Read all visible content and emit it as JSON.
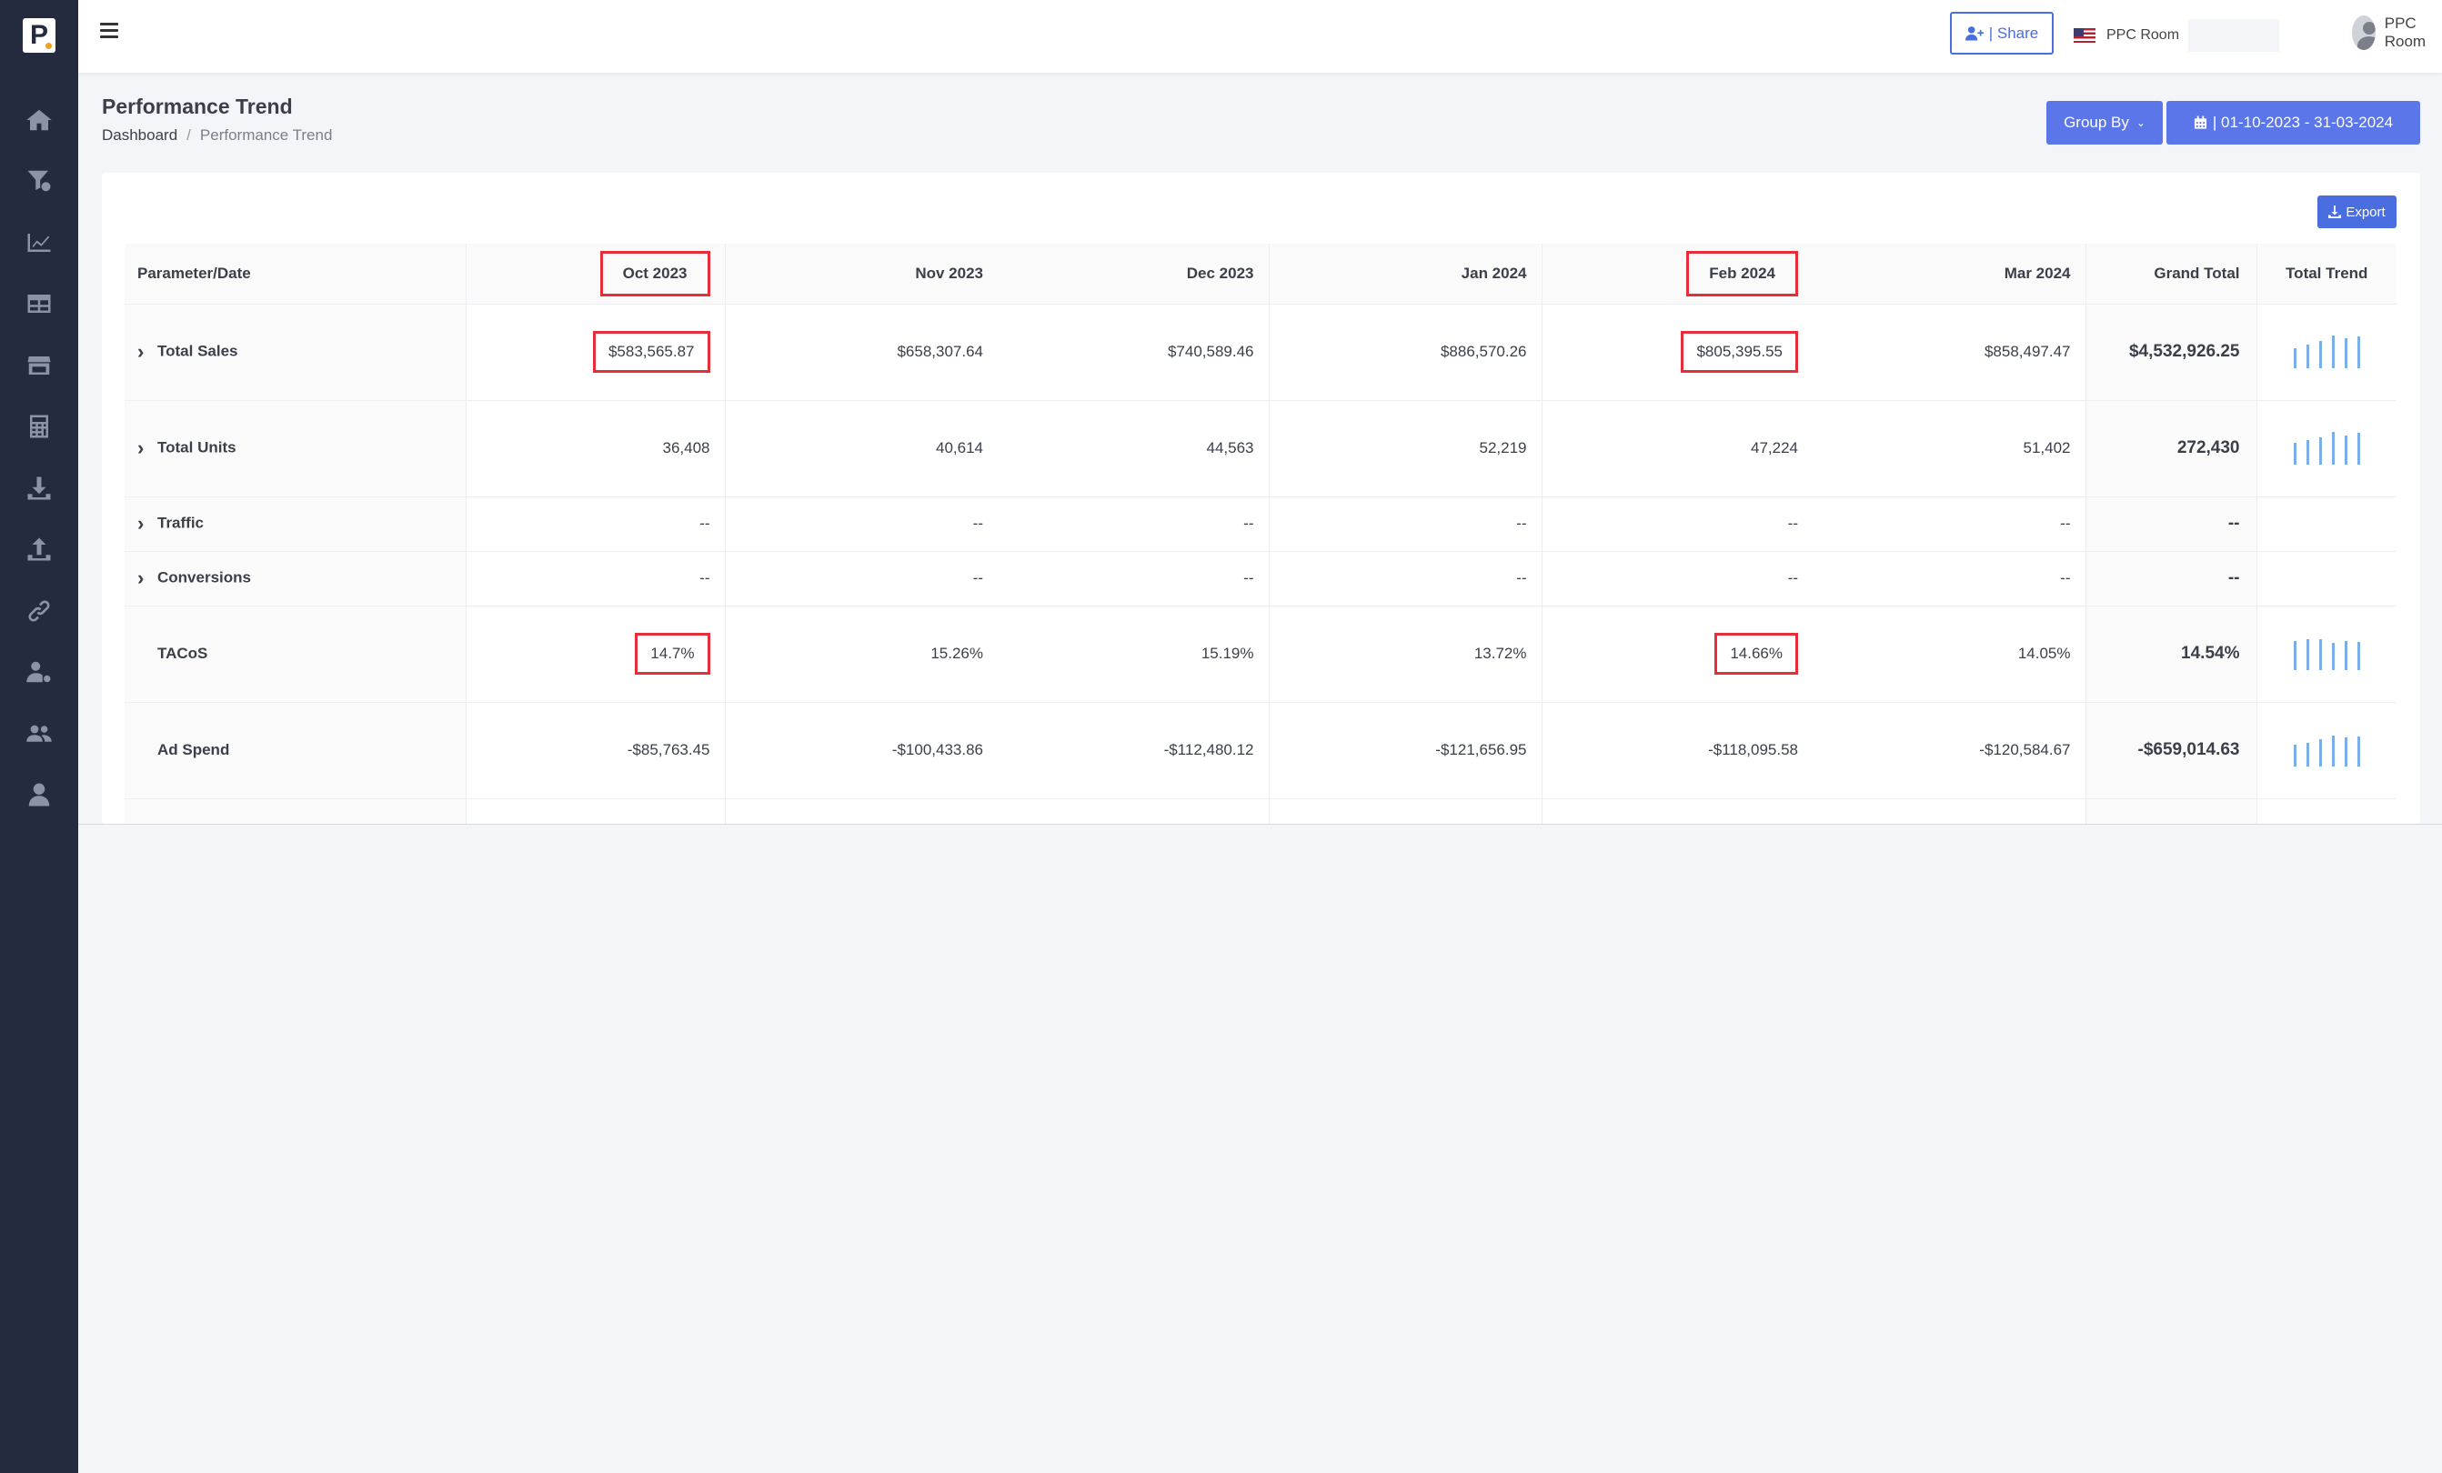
{
  "app": {
    "brand_letter": "P"
  },
  "sidebar": {
    "items": [
      {
        "name": "home-icon"
      },
      {
        "name": "filter-icon"
      },
      {
        "name": "chart-line-icon"
      },
      {
        "name": "table-icon"
      },
      {
        "name": "store-icon"
      },
      {
        "name": "calculator-icon"
      },
      {
        "name": "download-icon"
      },
      {
        "name": "upload-icon"
      },
      {
        "name": "link-icon"
      },
      {
        "name": "user-settings-icon"
      },
      {
        "name": "users-icon"
      },
      {
        "name": "user-icon"
      }
    ]
  },
  "topbar": {
    "share_label": "| Share",
    "account_name": "PPC Room",
    "user_name": "PPC Room"
  },
  "page": {
    "title": "Performance Trend",
    "breadcrumb": {
      "home": "Dashboard",
      "separator": "/",
      "current": "Performance Trend"
    },
    "group_by_label": "Group By",
    "date_range_label": "| 01-10-2023 - 31-03-2024",
    "export_label": "Export"
  },
  "table": {
    "headers": {
      "param": "Parameter/Date",
      "months": [
        "Oct 2023",
        "Nov 2023",
        "Dec 2023",
        "Jan 2024",
        "Feb 2024",
        "Mar 2024"
      ],
      "grand_total": "Grand Total",
      "trend": "Total Trend"
    },
    "rows": [
      {
        "label": "Total Sales",
        "values": [
          "$583,565.87",
          "$658,307.64",
          "$740,589.46",
          "$886,570.26",
          "$805,395.55",
          "$858,497.47"
        ],
        "total": "$4,532,926.25"
      },
      {
        "label": "Total Units",
        "values": [
          "36,408",
          "40,614",
          "44,563",
          "52,219",
          "47,224",
          "51,402"
        ],
        "total": "272,430"
      },
      {
        "label": "Traffic",
        "values": [
          "--",
          "--",
          "--",
          "--",
          "--",
          "--"
        ],
        "total": "--"
      },
      {
        "label": "Conversions",
        "values": [
          "--",
          "--",
          "--",
          "--",
          "--",
          "--"
        ],
        "total": "--"
      },
      {
        "label": "TACoS",
        "values": [
          "14.7%",
          "15.26%",
          "15.19%",
          "13.72%",
          "14.66%",
          "14.05%"
        ],
        "total": "14.54%"
      },
      {
        "label": "Ad Spend",
        "values": [
          "-$85,763.45",
          "-$100,433.86",
          "-$112,480.12",
          "-$121,656.95",
          "-$118,095.58",
          "-$120,584.67"
        ],
        "total": "-$659,014.63"
      }
    ]
  },
  "colors": {
    "sidebar_bg": "#242b3f",
    "accent": "#5a76e8",
    "highlight_box": "#e62e3b",
    "sparkline": "#79aee6"
  }
}
